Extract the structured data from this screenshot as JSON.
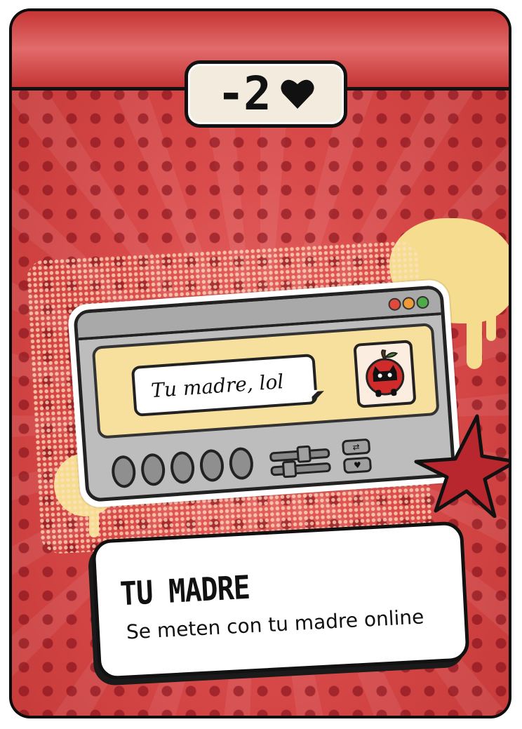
{
  "card": {
    "cost": "-2",
    "cost_icon": "heart-icon",
    "name": "TU MADRE",
    "description": "Se meten con tu madre online"
  },
  "chat_window": {
    "message": "Tu madre, lol",
    "avatar_icon": "apple-cat-icon"
  },
  "colors": {
    "card_red": "#d94a4a",
    "dot_red": "#7a0a14",
    "paint_yellow": "#f6dc8e",
    "star_red": "#b8262e"
  }
}
